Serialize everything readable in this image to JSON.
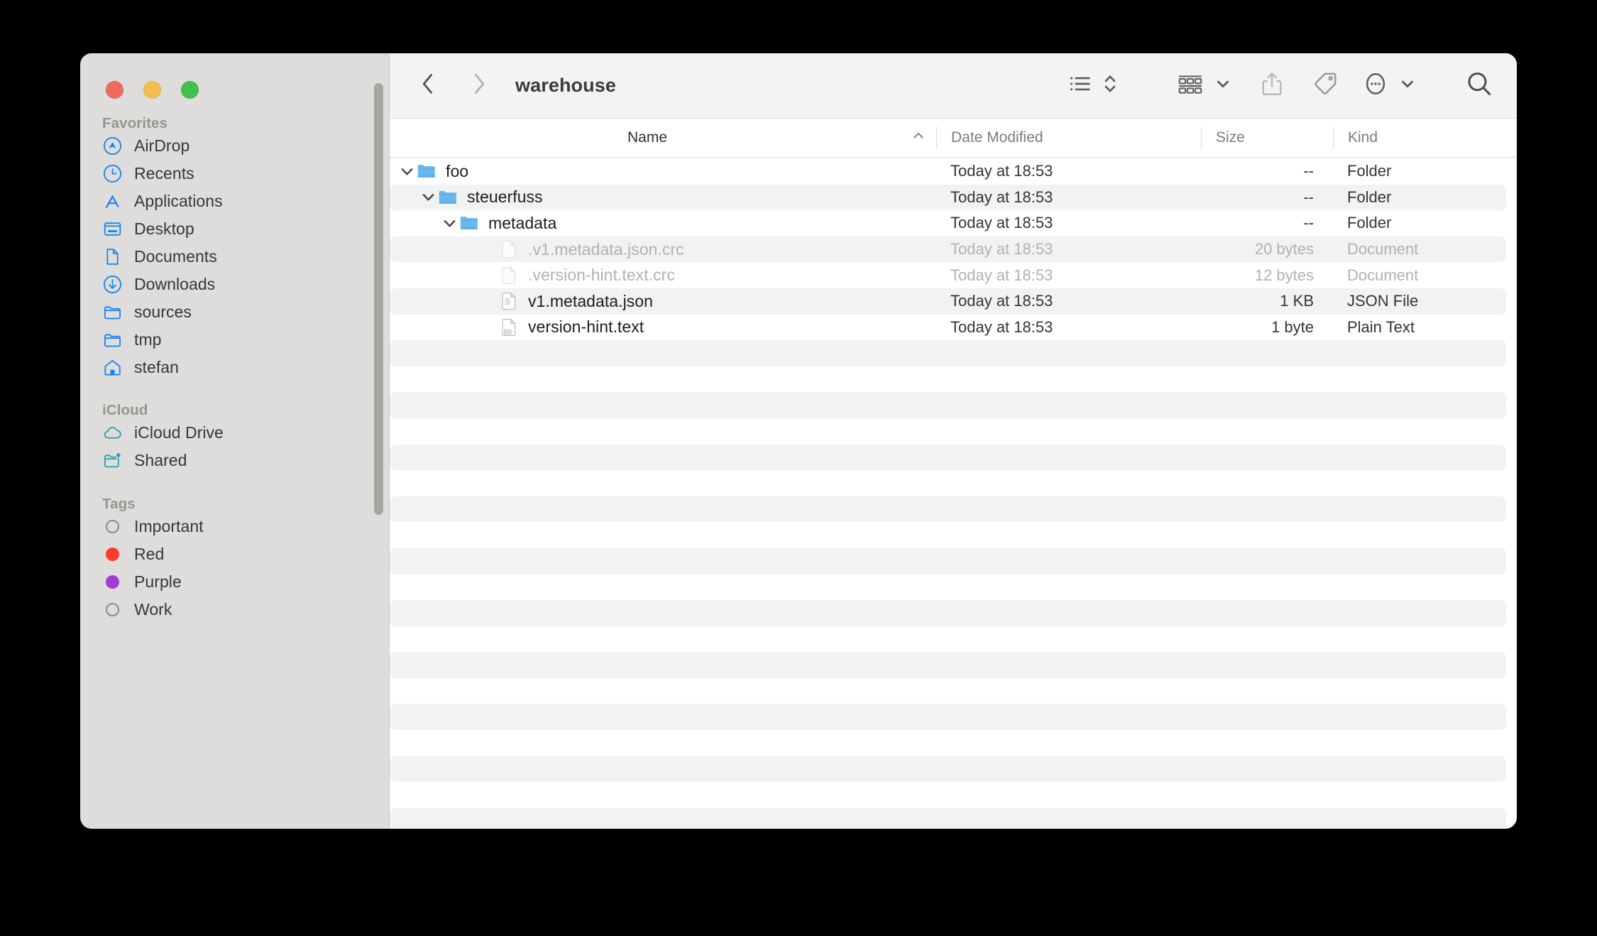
{
  "window": {
    "title": "warehouse",
    "traffic_lights": [
      {
        "name": "close",
        "color": "#ee6a5f"
      },
      {
        "name": "minimize",
        "color": "#f5bd4f"
      },
      {
        "name": "zoom",
        "color": "#3fc14b"
      }
    ]
  },
  "toolbar": {
    "back_icon": "chevron-left-icon",
    "forward_icon": "chevron-right-icon",
    "folder_name": "warehouse",
    "view_list_icon": "list-view-icon",
    "sort_icon": "sort-updown-icon",
    "group_icon": "group-view-icon",
    "group_chevron_icon": "chevron-down-icon",
    "share_icon": "share-icon",
    "tag_icon": "tag-icon",
    "more_icon": "more-ellipsis-icon",
    "more_chevron_icon": "chevron-down-icon",
    "search_icon": "search-icon"
  },
  "sidebar": {
    "sections": [
      {
        "title": "Favorites",
        "items": [
          {
            "label": "AirDrop",
            "icon": "airdrop-icon"
          },
          {
            "label": "Recents",
            "icon": "clock-icon"
          },
          {
            "label": "Applications",
            "icon": "applications-icon"
          },
          {
            "label": "Desktop",
            "icon": "desktop-icon"
          },
          {
            "label": "Documents",
            "icon": "document-icon"
          },
          {
            "label": "Downloads",
            "icon": "downloads-icon"
          },
          {
            "label": "sources",
            "icon": "folder-icon"
          },
          {
            "label": "tmp",
            "icon": "folder-icon"
          },
          {
            "label": "stefan",
            "icon": "home-icon"
          }
        ]
      },
      {
        "title": "iCloud",
        "items": [
          {
            "label": "iCloud Drive",
            "icon": "cloud-icon"
          },
          {
            "label": "Shared",
            "icon": "shared-folder-icon"
          }
        ]
      },
      {
        "title": "Tags",
        "items": [
          {
            "label": "Important",
            "icon": "tag-dot-icon",
            "color": "none",
            "hollow": true
          },
          {
            "label": "Red",
            "icon": "tag-dot-icon",
            "color": "#fc3b2d",
            "hollow": false
          },
          {
            "label": "Purple",
            "icon": "tag-dot-icon",
            "color": "#a martin",
            "hollow": false
          },
          {
            "label": "Work",
            "icon": "tag-dot-icon",
            "color": "none",
            "hollow": true
          }
        ]
      }
    ]
  },
  "columns": {
    "name": "Name",
    "date_modified": "Date Modified",
    "size": "Size",
    "kind": "Kind",
    "sort_indicator": "chevron-up-icon"
  },
  "files": [
    {
      "name": "foo",
      "icon": "folder-icon",
      "indent": 0,
      "expanded": true,
      "date": "Today at 18:53",
      "size": "--",
      "kind": "Folder",
      "striped": false,
      "dimmed": false
    },
    {
      "name": "steuerfuss",
      "icon": "folder-icon",
      "indent": 1,
      "expanded": true,
      "date": "Today at 18:53",
      "size": "--",
      "kind": "Folder",
      "striped": true,
      "dimmed": false
    },
    {
      "name": "metadata",
      "icon": "folder-icon",
      "indent": 2,
      "expanded": true,
      "date": "Today at 18:53",
      "size": "--",
      "kind": "Folder",
      "striped": false,
      "dimmed": false
    },
    {
      "name": ".v1.metadata.json.crc",
      "icon": "blank-doc-icon",
      "indent": 3,
      "expanded": null,
      "date": "Today at 18:53",
      "size": "20 bytes",
      "kind": "Document",
      "striped": true,
      "dimmed": true
    },
    {
      "name": ".version-hint.text.crc",
      "icon": "blank-doc-icon",
      "indent": 3,
      "expanded": null,
      "date": "Today at 18:53",
      "size": "12 bytes",
      "kind": "Document",
      "striped": false,
      "dimmed": true
    },
    {
      "name": "v1.metadata.json",
      "icon": "json-doc-icon",
      "indent": 3,
      "expanded": null,
      "date": "Today at 18:53",
      "size": "1 KB",
      "kind": "JSON File",
      "striped": true,
      "dimmed": false
    },
    {
      "name": "version-hint.text",
      "icon": "txt-doc-icon",
      "indent": 3,
      "expanded": null,
      "date": "Today at 18:53",
      "size": "1 byte",
      "kind": "Plain Text",
      "striped": false,
      "dimmed": false
    }
  ],
  "empty_row_count": 21
}
